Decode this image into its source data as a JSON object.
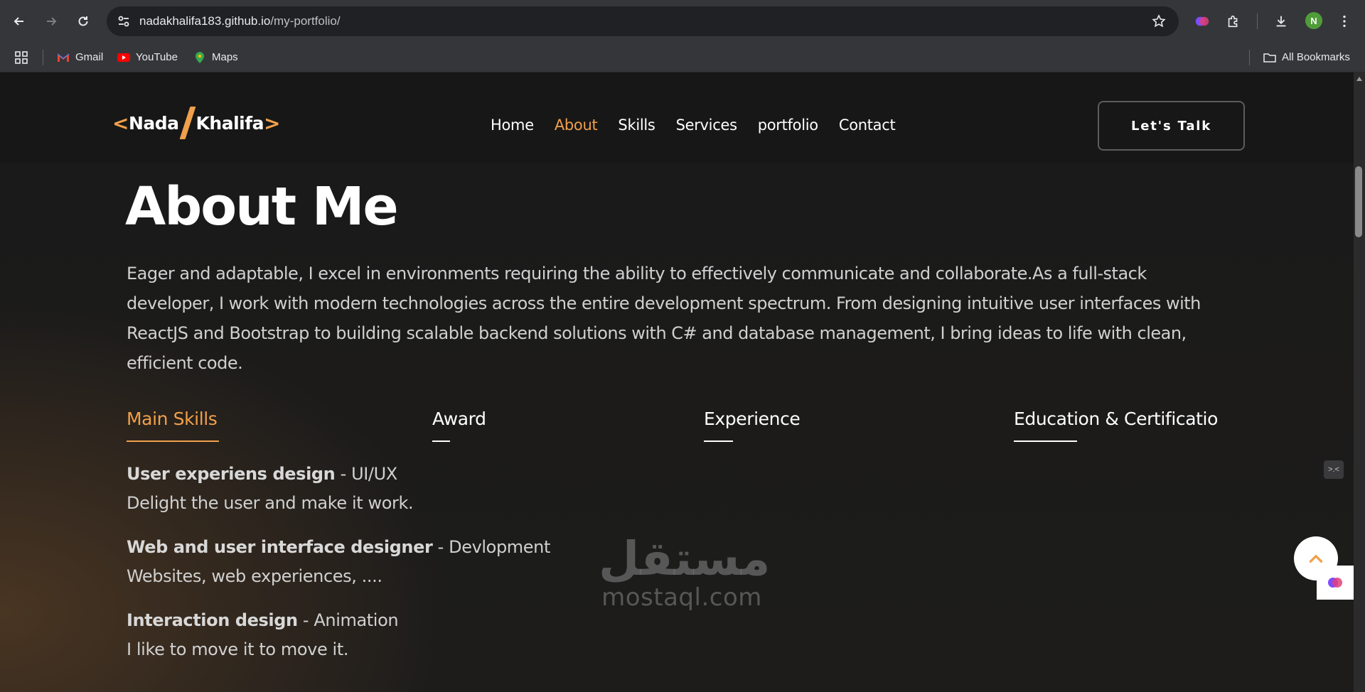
{
  "browser": {
    "url_host": "nadakhalifa183.github.io",
    "url_path": "/my-portfolio/",
    "avatar_letter": "N",
    "bookmarks": [
      {
        "label": "Gmail",
        "icon": "gmail-icon"
      },
      {
        "label": "YouTube",
        "icon": "youtube-icon"
      },
      {
        "label": "Maps",
        "icon": "maps-icon"
      }
    ],
    "all_bookmarks": "All Bookmarks"
  },
  "header": {
    "logo_first": "Nada",
    "logo_last": "Khalifa",
    "logo_left": "<",
    "logo_right": ">",
    "nav": [
      {
        "label": "Home",
        "active": false
      },
      {
        "label": "About",
        "active": true
      },
      {
        "label": "Skills",
        "active": false
      },
      {
        "label": "Services",
        "active": false
      },
      {
        "label": "portfolio",
        "active": false
      },
      {
        "label": "Contact",
        "active": false
      }
    ],
    "cta": "Let's Talk"
  },
  "about": {
    "title": "About Me",
    "text": "Eager and adaptable, I excel in environments requiring the ability to effectively communicate and collaborate.As a full-stack developer, I work with modern technologies across the entire development spectrum. From designing intuitive user interfaces with ReactJS and Bootstrap to building scalable backend solutions with C# and database management, I bring ideas to life with clean, efficient code.",
    "tabs": [
      {
        "label": "Main Skills",
        "active": true
      },
      {
        "label": "Award",
        "active": false
      },
      {
        "label": "Experience",
        "active": false
      },
      {
        "label": "Education & Certificatio",
        "active": false
      }
    ],
    "skills": [
      {
        "title": "User experiens design",
        "tag": " - UI/UX",
        "desc": "Delight the user and make it work."
      },
      {
        "title": "Web and user interface designer",
        "tag": " - Devlopment",
        "desc": "Websites, web experiences, ...."
      },
      {
        "title": "Interaction design",
        "tag": " - Animation",
        "desc": "I like to move it to move it."
      }
    ]
  },
  "watermark": {
    "arabic": "مستقل",
    "latin": "mostaql.com"
  },
  "side_tag": ">.<",
  "colors": {
    "accent": "#f0a04b",
    "background": "#1b1b1b",
    "text": "#d0d0d0"
  }
}
